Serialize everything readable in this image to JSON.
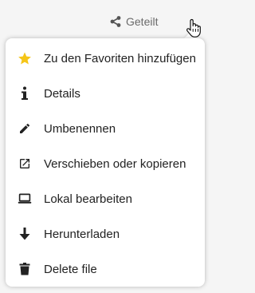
{
  "header": {
    "share_label": "Geteilt",
    "share_icon": "share-icon",
    "more_icon": "more-icon"
  },
  "menu": {
    "items": [
      {
        "label": "Zu den Favoriten hinzufügen",
        "icon": "star-icon"
      },
      {
        "label": "Details",
        "icon": "info-icon"
      },
      {
        "label": "Umbenennen",
        "icon": "pencil-icon"
      },
      {
        "label": "Verschieben oder kopieren",
        "icon": "external-link-icon"
      },
      {
        "label": "Lokal bearbeiten",
        "icon": "laptop-icon"
      },
      {
        "label": "Herunterladen",
        "icon": "download-icon"
      },
      {
        "label": "Delete file",
        "icon": "trash-icon"
      }
    ]
  },
  "colors": {
    "star": "#f5c518",
    "text": "#222222",
    "muted": "#6b6b6b",
    "icon": "#222222"
  }
}
